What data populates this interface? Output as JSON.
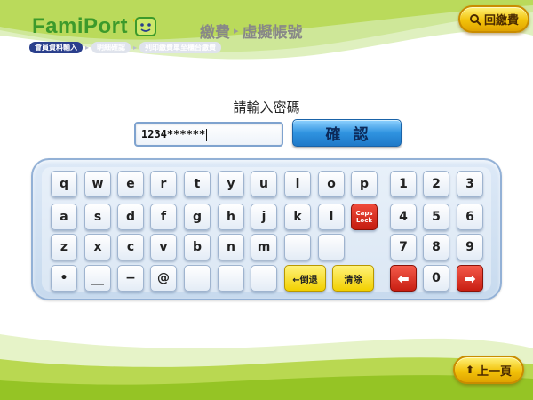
{
  "header": {
    "brand_logo_text": "FamiPort",
    "title_category": "繳費",
    "title_arrow": "▸",
    "title_page": "虛擬帳號",
    "steps": [
      "會員資料輸入",
      "明細確認",
      "列印繳費單至櫃台繳費"
    ],
    "step_arrow": "▸",
    "back_label": "回繳費",
    "back_icon": "search-icon"
  },
  "password": {
    "prompt": "請輸入密碼",
    "value": "1234******",
    "confirm_label": "確認"
  },
  "keyboard": {
    "letter_rows": [
      [
        "q",
        "w",
        "e",
        "r",
        "t",
        "y",
        "u",
        "i",
        "o",
        "p"
      ],
      [
        "a",
        "s",
        "d",
        "f",
        "g",
        "h",
        "j",
        "k",
        "l"
      ],
      [
        "z",
        "x",
        "c",
        "v",
        "b",
        "n",
        "m",
        "",
        ""
      ],
      [
        "•",
        "__",
        "−",
        "@",
        "",
        "",
        ""
      ]
    ],
    "caps_label": "Caps\nLock",
    "backspace_label": "←倒退",
    "clear_label": "清除",
    "numpad": [
      [
        "1",
        "2",
        "3"
      ],
      [
        "4",
        "5",
        "6"
      ],
      [
        "7",
        "8",
        "9"
      ]
    ],
    "left_arrow": "⬅",
    "zero": "0",
    "right_arrow": "➡"
  },
  "footer": {
    "prev_label": "上一頁",
    "prev_icon": "up-arrow-icon"
  },
  "colors": {
    "brand_green": "#3c9a2b",
    "lime_swoosh": "#a9cf2a",
    "step_active": "#2a3f8c",
    "confirm_blue": "#2f93e0",
    "pill_yellow": "#f2c20a",
    "caps_red": "#c41c10"
  }
}
